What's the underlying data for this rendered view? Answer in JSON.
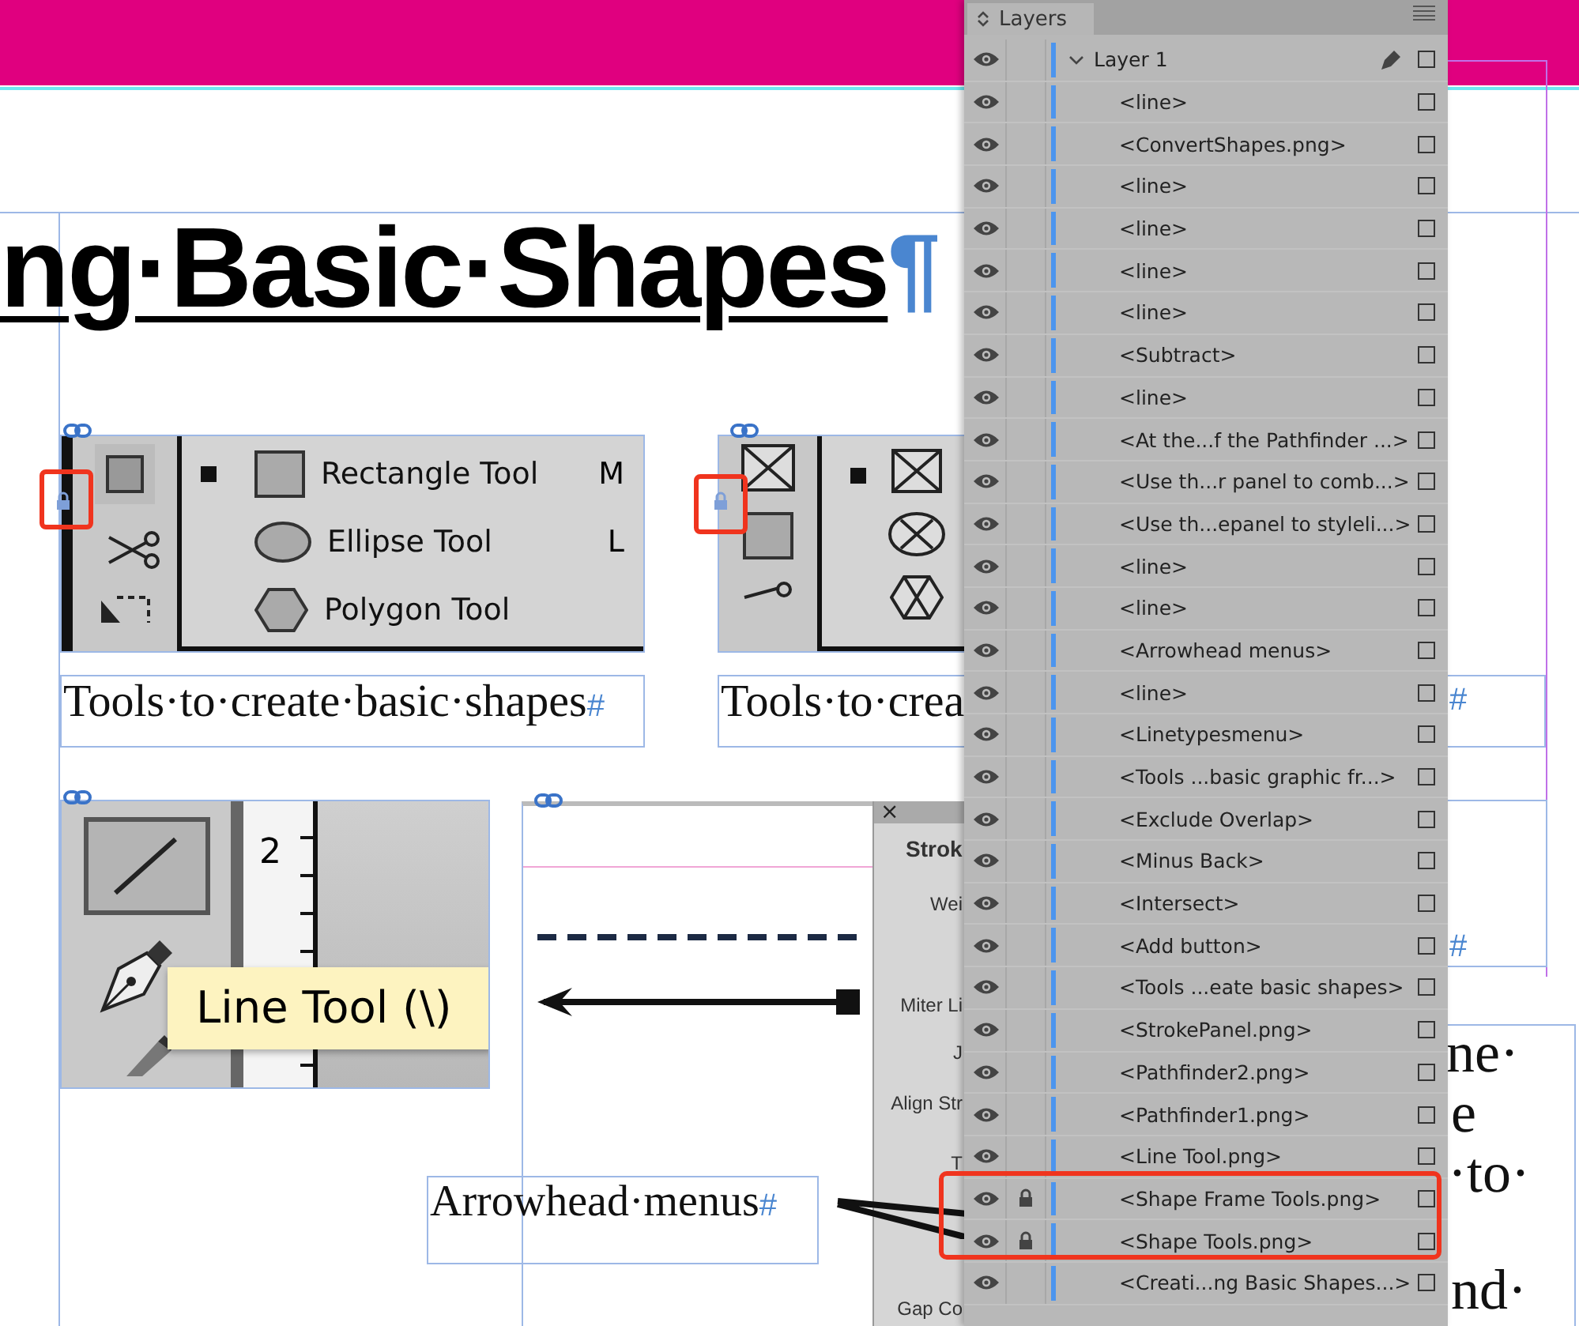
{
  "document": {
    "heading": {
      "text": "ng·Basic·Shapes",
      "mark": "¶"
    },
    "shape_tools_frame": {
      "locked": true,
      "flyout": [
        {
          "kind": "rectangle",
          "label": "Rectangle Tool",
          "shortcut": "M",
          "current": true
        },
        {
          "kind": "ellipse",
          "label": "Ellipse Tool",
          "shortcut": "L",
          "current": false
        },
        {
          "kind": "polygon",
          "label": "Polygon Tool",
          "current": false
        }
      ]
    },
    "caption_1": {
      "text": "Tools·to·create·basic·shapes",
      "end_mark": "#"
    },
    "frame_tools_frame": {
      "locked": true
    },
    "caption_2": {
      "text": "Tools·to·crea",
      "end_mark": "#"
    },
    "line_tool_frame": {
      "ruler_number": "2",
      "tooltip": "Line Tool (\\)"
    },
    "stroke_panel": {
      "close": "×",
      "title": "Strok",
      "labels": [
        "Wei",
        "Miter Li",
        "J",
        "Align Str",
        "T",
        "Gap Co"
      ]
    },
    "caption_3": {
      "text": "Arrowhead·menus",
      "end_mark": "#"
    },
    "other_end_mark": "#",
    "body_text_fragments": [
      "ne·",
      "e",
      "·to·",
      "nd·"
    ]
  },
  "layers_panel": {
    "title": "Layers",
    "layer": {
      "name": "Layer 1",
      "expanded": true,
      "visible": true,
      "items": [
        {
          "name": "<line>",
          "visible": true,
          "locked": false,
          "highlighted": false
        },
        {
          "name": "<ConvertShapes.png>",
          "visible": true,
          "locked": false,
          "highlighted": false
        },
        {
          "name": "<line>",
          "visible": true,
          "locked": false,
          "highlighted": false
        },
        {
          "name": "<line>",
          "visible": true,
          "locked": false,
          "highlighted": false
        },
        {
          "name": "<line>",
          "visible": true,
          "locked": false,
          "highlighted": false
        },
        {
          "name": "<line>",
          "visible": true,
          "locked": false,
          "highlighted": false
        },
        {
          "name": "<Subtract>",
          "visible": true,
          "locked": false,
          "highlighted": false
        },
        {
          "name": "<line>",
          "visible": true,
          "locked": false,
          "highlighted": false
        },
        {
          "name": "<At the...f the Pathfinder ...>",
          "visible": true,
          "locked": false,
          "highlighted": false
        },
        {
          "name": "<Use th...r panel to comb...>",
          "visible": true,
          "locked": false,
          "highlighted": false
        },
        {
          "name": "<Use th...epanel to styleli...>",
          "visible": true,
          "locked": false,
          "highlighted": false
        },
        {
          "name": "<line>",
          "visible": true,
          "locked": false,
          "highlighted": false
        },
        {
          "name": "<line>",
          "visible": true,
          "locked": false,
          "highlighted": false
        },
        {
          "name": "<Arrowhead menus>",
          "visible": true,
          "locked": false,
          "highlighted": false
        },
        {
          "name": "<line>",
          "visible": true,
          "locked": false,
          "highlighted": false
        },
        {
          "name": "<Linetypesmenu>",
          "visible": true,
          "locked": false,
          "highlighted": false
        },
        {
          "name": "<Tools ...basic graphic fr...>",
          "visible": true,
          "locked": false,
          "highlighted": false
        },
        {
          "name": "<Exclude Overlap>",
          "visible": true,
          "locked": false,
          "highlighted": false
        },
        {
          "name": "<Minus Back>",
          "visible": true,
          "locked": false,
          "highlighted": false
        },
        {
          "name": "<Intersect>",
          "visible": true,
          "locked": false,
          "highlighted": false
        },
        {
          "name": "<Add button>",
          "visible": true,
          "locked": false,
          "highlighted": false
        },
        {
          "name": "<Tools ...eate basic shapes>",
          "visible": true,
          "locked": false,
          "highlighted": false
        },
        {
          "name": "<StrokePanel.png>",
          "visible": true,
          "locked": false,
          "highlighted": false
        },
        {
          "name": "<Pathfinder2.png>",
          "visible": true,
          "locked": false,
          "highlighted": false
        },
        {
          "name": "<Pathfinder1.png>",
          "visible": true,
          "locked": false,
          "highlighted": false
        },
        {
          "name": "<Line Tool.png>",
          "visible": true,
          "locked": false,
          "highlighted": false
        },
        {
          "name": "<Shape Frame Tools.png>",
          "visible": true,
          "locked": true,
          "highlighted": true
        },
        {
          "name": "<Shape Tools.png>",
          "visible": true,
          "locked": true,
          "highlighted": true
        },
        {
          "name": "<Creati...ng Basic Shapes...>",
          "visible": true,
          "locked": false,
          "highlighted": false
        }
      ]
    }
  }
}
